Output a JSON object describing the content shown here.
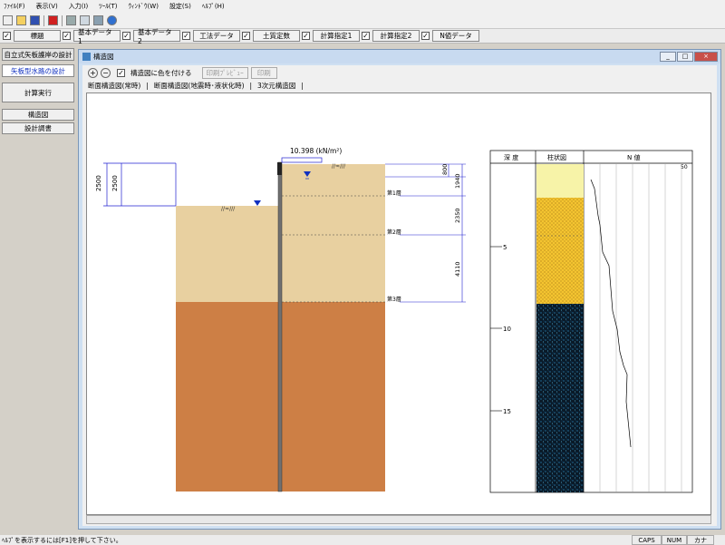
{
  "menu": [
    "ﾌｧｲﾙ(F)",
    "表示(V)",
    "入力(I)",
    "ﾂｰﾙ(T)",
    "ｳｨﾝﾄﾞｳ(W)",
    "設定(S)",
    "ﾍﾙﾌﾟ(H)"
  ],
  "toolbar_icons": [
    "new-icon",
    "open-icon",
    "save-icon",
    "red-tool-icon",
    "print-icon",
    "print-preview-icon",
    "print-setup-icon",
    "help-icon"
  ],
  "input_tabs": [
    "標題",
    "基本データ1",
    "基本データ2",
    "工法データ",
    "土質定数",
    "計算指定1",
    "計算指定2",
    "N値データ"
  ],
  "left": {
    "title": "自立式矢板護岸の設計",
    "tab": "矢板型水路の設計",
    "calc": "計算実行",
    "struct": "構造図",
    "report": "設計調書"
  },
  "window": {
    "title": "構造図",
    "min": "_",
    "max": "□",
    "close": "×"
  },
  "subtoolbar": {
    "color_label": "構造図に色を付ける",
    "print_preview": "印刷ﾌﾟﾚﾋﾞｭｰ",
    "print": "印刷"
  },
  "view_tabs": [
    "断面構造図(常時)",
    "断面構造図(地震時･液状化時)",
    "3次元構造図"
  ],
  "drawing": {
    "load": "10.398 (kN/m²)",
    "left_dim_outer": "2500",
    "left_dim_inner": "2500",
    "right_dims": [
      "800",
      "1940",
      "2350",
      "4110"
    ],
    "layers": [
      "第1層",
      "第2層",
      "第3層"
    ]
  },
  "boring": {
    "col_depth": "深 度",
    "col_column": "柱状図",
    "col_n": "N 値",
    "n_tick": "50",
    "depths": [
      "5",
      "10",
      "15"
    ]
  },
  "status": {
    "help": "ﾍﾙﾌﾟを表示するには[F1]を押して下さい。",
    "caps": "CAPS",
    "num": "NUM",
    "kana": "カナ"
  },
  "colors": {
    "sand": "#e8d0a0",
    "clay": "#cd7f45",
    "fill_yellow": "#f7f3a8",
    "gravel": "#f4c430",
    "rock": "#0a1a28",
    "water": "#1030c0",
    "dims": "#2020d0"
  }
}
